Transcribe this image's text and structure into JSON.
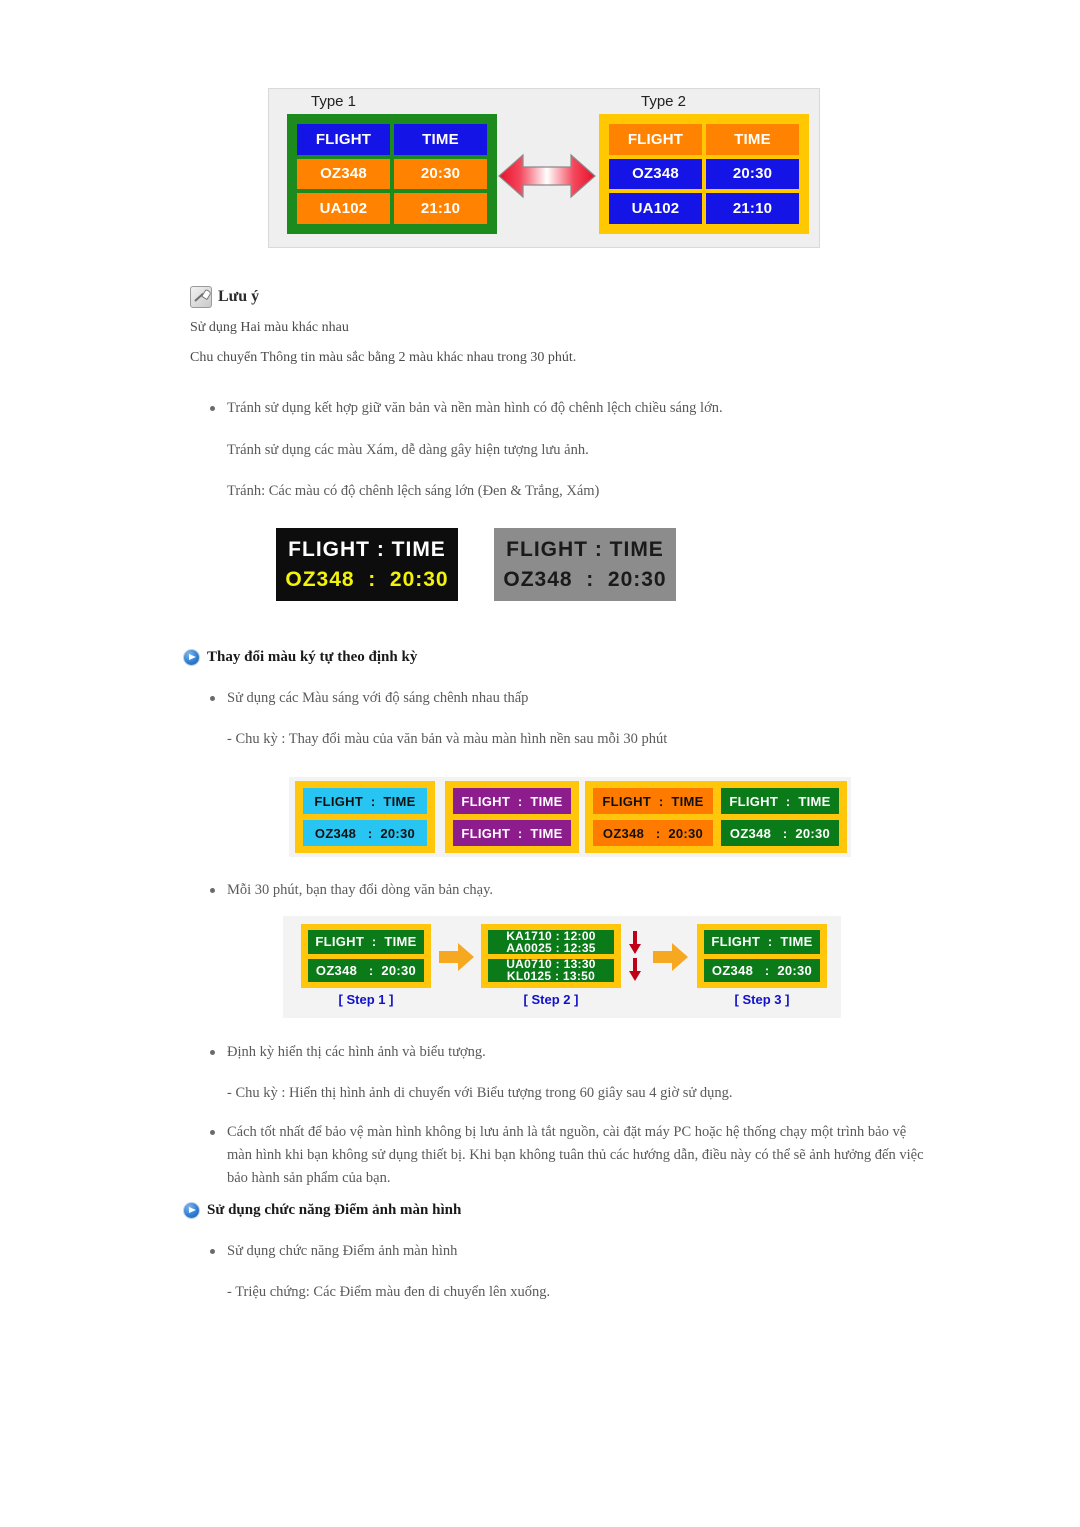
{
  "figure_type_compare": {
    "name": "type-1-type-2-flight-board",
    "label_type1": "Type 1",
    "label_type2": "Type 2",
    "arrow_icon": "double-horizontal-arrow-icon",
    "board_type1": {
      "border_color": "#1d8a1d",
      "rows": [
        {
          "left": "FLIGHT",
          "right": "TIME",
          "left_bg": "#1414e6",
          "right_bg": "#1414e6"
        },
        {
          "left": "OZ348",
          "right": "20:30",
          "left_bg": "#ff8200",
          "right_bg": "#ff8200"
        },
        {
          "left": "UA102",
          "right": "21:10",
          "left_bg": "#ff8200",
          "right_bg": "#ff8200"
        }
      ]
    },
    "board_type2": {
      "border_color": "#ffc800",
      "rows": [
        {
          "left": "FLIGHT",
          "right": "TIME",
          "left_bg": "#ff8200",
          "right_bg": "#ff8200"
        },
        {
          "left": "OZ348",
          "right": "20:30",
          "left_bg": "#1414e6",
          "right_bg": "#1414e6"
        },
        {
          "left": "UA102",
          "right": "21:10",
          "left_bg": "#1414e6",
          "right_bg": "#1414e6"
        }
      ]
    }
  },
  "note": {
    "icon": "note-pencil-icon",
    "title": "Lưu ý",
    "line1": "Sử dụng Hai màu khác nhau",
    "line2": "Chu chuyển Thông tin màu sắc bằng 2 màu khác nhau trong 30 phút."
  },
  "avoid_list": {
    "item1": "Tránh sử dụng kết hợp giữ văn bản và nền màn hình có độ chênh lệch chiều sáng lớn.",
    "item2": "Tránh sử dụng các màu Xám, dễ dàng gây hiện tượng lưu ảnh.",
    "item3": "Tránh: Các màu có độ chênh lệch sáng lớn (Đen & Trắng, Xám)"
  },
  "figure_contrast": {
    "name": "black-and-gray-flight-time-samples",
    "black_box": {
      "bg": "#0d0d0d",
      "line1": "FLIGHT : TIME",
      "line1_color": "#ffffff",
      "line2": "OZ348  :  20:30",
      "line2_color": "#f2f20a"
    },
    "gray_box": {
      "bg": "#8c8c8c",
      "line1": "FLIGHT : TIME",
      "line1_color": "#1a1a1a",
      "line2": "OZ348  :  20:30",
      "line2_color": "#1a1a1a"
    }
  },
  "section_color_change": {
    "icon": "blue-arrow-bullet-icon",
    "heading": "Thay đổi màu ký tự theo định kỳ",
    "bullet1": "Sử dụng các Màu sáng với độ sáng chênh nhau thấp",
    "sub1": "- Chu kỳ : Thay đổi màu của văn bản và màu màn hình nền sau mỗi 30 phút",
    "bullet2": "Mỗi 30 phút, bạn thay đổi dòng văn bản chạy."
  },
  "figure_color_panels": {
    "name": "four-colour-flight-time-panels",
    "frame_color": "#ffc60b",
    "panels": [
      {
        "bg_name": "cyan",
        "bg": "#29c5f2",
        "text_color": "#111111",
        "line1": "FLIGHT  :  TIME",
        "line2": "OZ348   :  20:30"
      },
      {
        "bg_name": "purple",
        "bg": "#8d1c8d",
        "text_color": "#ffffff",
        "line1": "FLIGHT  :  TIME",
        "line2": "FLIGHT  :  TIME"
      },
      {
        "bg_name": "orange",
        "bg": "#ff7b00",
        "text_color": "#111111",
        "line1": "FLIGHT  :  TIME",
        "line2": "OZ348   :  20:30"
      },
      {
        "bg_name": "green",
        "bg": "#0b7a19",
        "text_color": "#ffffff",
        "line1": "FLIGHT  :  TIME",
        "line2": "OZ348   :  20:30"
      }
    ]
  },
  "figure_steps": {
    "name": "scrolling-text-step-diagram",
    "frame_color": "#ffc60b",
    "panel_color": "#0b7a19",
    "arrow_icon": "orange-right-arrow-icon",
    "down_arrow_icon": "red-down-arrow-icon",
    "steps": [
      {
        "label": "[ Step 1 ]",
        "line1": "FLIGHT  :  TIME",
        "line2": "OZ348   :  20:30",
        "scrolling": false
      },
      {
        "label": "[ Step 2 ]",
        "line1a": "KA1710 : 12:00",
        "line1b": "AA0025 : 12:35",
        "line2a": "UA0710 : 13:30",
        "line2b": "KL0125 : 13:50",
        "scrolling": true
      },
      {
        "label": "[ Step 3 ]",
        "line1": "FLIGHT  :  TIME",
        "line2": "OZ348   :  20:30",
        "scrolling": false
      }
    ]
  },
  "section_image_display": {
    "bullet1": "Định kỳ hiển thị các hình ảnh và biểu tượng.",
    "sub1": "- Chu kỳ : Hiển thị hình ảnh di chuyển với Biểu tượng trong 60 giây sau 4 giờ sử dụng.",
    "bullet2_line1": "Cách tốt nhất để bảo vệ màn hình không bị lưu ảnh là tắt nguồn, cài đặt máy PC hoặc hệ thống chạy một trình bảo vệ",
    "bullet2_line2": "màn hình khi bạn không sử dụng thiết bị. Khi bạn không tuân thủ các hướng dẫn, điều này có thể sẽ ảnh hưởng đến việc",
    "bullet2_line3": "bảo hành sản phẩm của bạn."
  },
  "section_pixel_shift": {
    "icon": "blue-arrow-bullet-icon",
    "heading": "Sử dụng chức năng Điểm ảnh màn hình",
    "bullet1": "Sử dụng chức năng Điểm ảnh màn hình",
    "sub1": "- Triệu chứng: Các Điểm màu đen di chuyển lên xuống."
  }
}
